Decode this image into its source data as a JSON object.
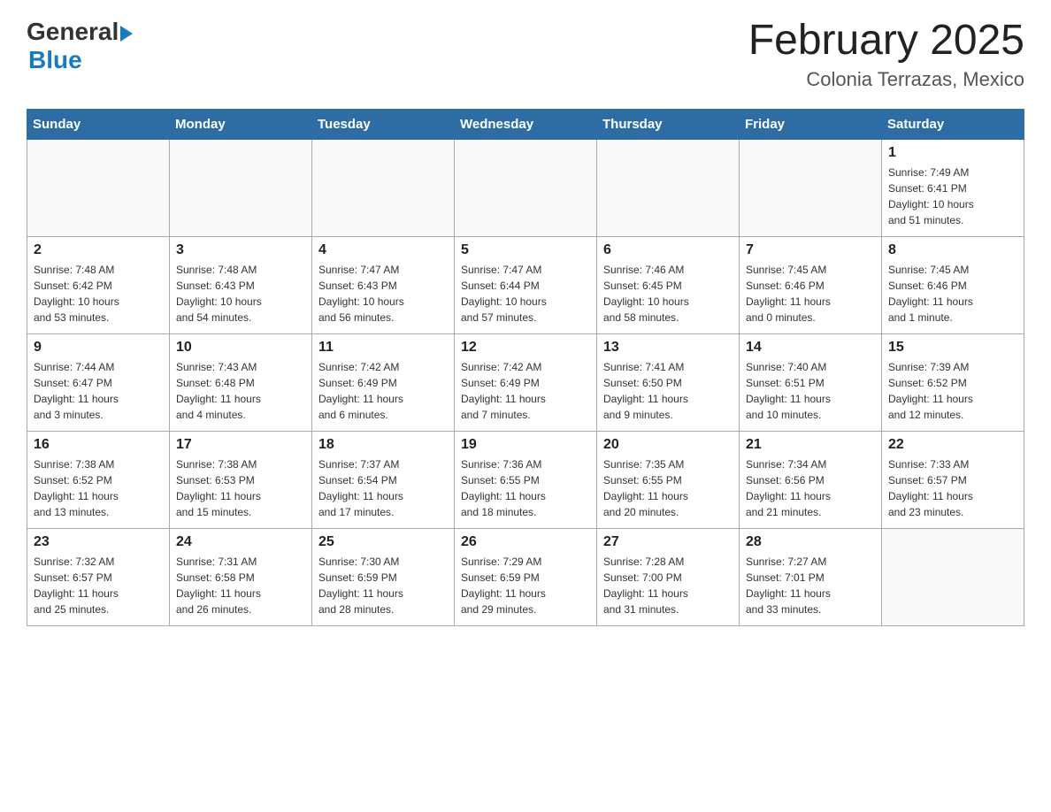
{
  "logo": {
    "general": "General",
    "blue": "Blue"
  },
  "title": "February 2025",
  "subtitle": "Colonia Terrazas, Mexico",
  "headers": [
    "Sunday",
    "Monday",
    "Tuesday",
    "Wednesday",
    "Thursday",
    "Friday",
    "Saturday"
  ],
  "weeks": [
    [
      {
        "day": "",
        "info": ""
      },
      {
        "day": "",
        "info": ""
      },
      {
        "day": "",
        "info": ""
      },
      {
        "day": "",
        "info": ""
      },
      {
        "day": "",
        "info": ""
      },
      {
        "day": "",
        "info": ""
      },
      {
        "day": "1",
        "info": "Sunrise: 7:49 AM\nSunset: 6:41 PM\nDaylight: 10 hours\nand 51 minutes."
      }
    ],
    [
      {
        "day": "2",
        "info": "Sunrise: 7:48 AM\nSunset: 6:42 PM\nDaylight: 10 hours\nand 53 minutes."
      },
      {
        "day": "3",
        "info": "Sunrise: 7:48 AM\nSunset: 6:43 PM\nDaylight: 10 hours\nand 54 minutes."
      },
      {
        "day": "4",
        "info": "Sunrise: 7:47 AM\nSunset: 6:43 PM\nDaylight: 10 hours\nand 56 minutes."
      },
      {
        "day": "5",
        "info": "Sunrise: 7:47 AM\nSunset: 6:44 PM\nDaylight: 10 hours\nand 57 minutes."
      },
      {
        "day": "6",
        "info": "Sunrise: 7:46 AM\nSunset: 6:45 PM\nDaylight: 10 hours\nand 58 minutes."
      },
      {
        "day": "7",
        "info": "Sunrise: 7:45 AM\nSunset: 6:46 PM\nDaylight: 11 hours\nand 0 minutes."
      },
      {
        "day": "8",
        "info": "Sunrise: 7:45 AM\nSunset: 6:46 PM\nDaylight: 11 hours\nand 1 minute."
      }
    ],
    [
      {
        "day": "9",
        "info": "Sunrise: 7:44 AM\nSunset: 6:47 PM\nDaylight: 11 hours\nand 3 minutes."
      },
      {
        "day": "10",
        "info": "Sunrise: 7:43 AM\nSunset: 6:48 PM\nDaylight: 11 hours\nand 4 minutes."
      },
      {
        "day": "11",
        "info": "Sunrise: 7:42 AM\nSunset: 6:49 PM\nDaylight: 11 hours\nand 6 minutes."
      },
      {
        "day": "12",
        "info": "Sunrise: 7:42 AM\nSunset: 6:49 PM\nDaylight: 11 hours\nand 7 minutes."
      },
      {
        "day": "13",
        "info": "Sunrise: 7:41 AM\nSunset: 6:50 PM\nDaylight: 11 hours\nand 9 minutes."
      },
      {
        "day": "14",
        "info": "Sunrise: 7:40 AM\nSunset: 6:51 PM\nDaylight: 11 hours\nand 10 minutes."
      },
      {
        "day": "15",
        "info": "Sunrise: 7:39 AM\nSunset: 6:52 PM\nDaylight: 11 hours\nand 12 minutes."
      }
    ],
    [
      {
        "day": "16",
        "info": "Sunrise: 7:38 AM\nSunset: 6:52 PM\nDaylight: 11 hours\nand 13 minutes."
      },
      {
        "day": "17",
        "info": "Sunrise: 7:38 AM\nSunset: 6:53 PM\nDaylight: 11 hours\nand 15 minutes."
      },
      {
        "day": "18",
        "info": "Sunrise: 7:37 AM\nSunset: 6:54 PM\nDaylight: 11 hours\nand 17 minutes."
      },
      {
        "day": "19",
        "info": "Sunrise: 7:36 AM\nSunset: 6:55 PM\nDaylight: 11 hours\nand 18 minutes."
      },
      {
        "day": "20",
        "info": "Sunrise: 7:35 AM\nSunset: 6:55 PM\nDaylight: 11 hours\nand 20 minutes."
      },
      {
        "day": "21",
        "info": "Sunrise: 7:34 AM\nSunset: 6:56 PM\nDaylight: 11 hours\nand 21 minutes."
      },
      {
        "day": "22",
        "info": "Sunrise: 7:33 AM\nSunset: 6:57 PM\nDaylight: 11 hours\nand 23 minutes."
      }
    ],
    [
      {
        "day": "23",
        "info": "Sunrise: 7:32 AM\nSunset: 6:57 PM\nDaylight: 11 hours\nand 25 minutes."
      },
      {
        "day": "24",
        "info": "Sunrise: 7:31 AM\nSunset: 6:58 PM\nDaylight: 11 hours\nand 26 minutes."
      },
      {
        "day": "25",
        "info": "Sunrise: 7:30 AM\nSunset: 6:59 PM\nDaylight: 11 hours\nand 28 minutes."
      },
      {
        "day": "26",
        "info": "Sunrise: 7:29 AM\nSunset: 6:59 PM\nDaylight: 11 hours\nand 29 minutes."
      },
      {
        "day": "27",
        "info": "Sunrise: 7:28 AM\nSunset: 7:00 PM\nDaylight: 11 hours\nand 31 minutes."
      },
      {
        "day": "28",
        "info": "Sunrise: 7:27 AM\nSunset: 7:01 PM\nDaylight: 11 hours\nand 33 minutes."
      },
      {
        "day": "",
        "info": ""
      }
    ]
  ]
}
